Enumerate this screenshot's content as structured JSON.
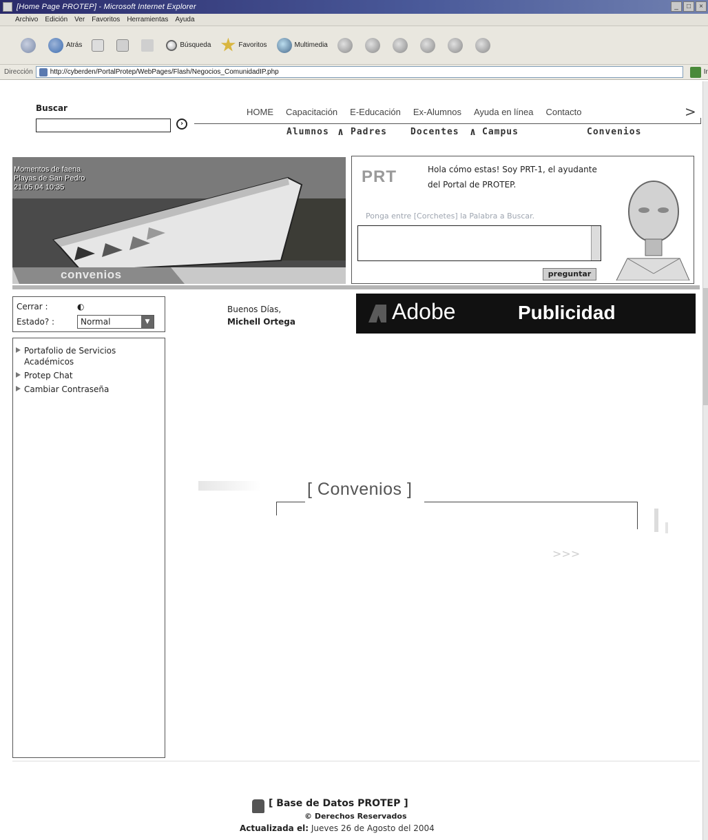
{
  "window": {
    "title": "[Home Page PROTEP] - Microsoft Internet Explorer"
  },
  "menubar": [
    "Archivo",
    "Edición",
    "Ver",
    "Favoritos",
    "Herramientas",
    "Ayuda"
  ],
  "toolbar": {
    "back_label": "Atrás",
    "search_label": "Búsqueda",
    "favorites_label": "Favoritos",
    "media_label": "Multimedia"
  },
  "address": {
    "label": "Dirección",
    "url": "http://cyberden/PortalProtep/WebPages/Flash/Negocios_ComunidadIP.php",
    "go_label": "Ir"
  },
  "search": {
    "label": "Buscar",
    "value": ""
  },
  "nav": {
    "top": [
      "HOME",
      "Capacitación",
      "E-Educación",
      "Ex-Alumnos",
      "Ayuda en línea",
      "Contacto"
    ],
    "more": ">",
    "sub": {
      "alumnos": "Alumnos",
      "padres": "Padres",
      "docentes": "Docentes",
      "campus": "Campus",
      "convenios": "Convenios"
    }
  },
  "banner": {
    "caption_line1": "Momentos de faena",
    "caption_line2": "Playas de San Pedro",
    "caption_line3": "21.05.04 10:35",
    "section": "convenios"
  },
  "assistant": {
    "logo": "PRT",
    "greeting": "Hola cómo estas! Soy PRT-1, el ayudante del Portal de PROTEP.",
    "hint": "Ponga entre [Corchetes] la Palabra a Buscar.",
    "ask_value": "",
    "ask_button": "preguntar"
  },
  "status": {
    "close_label": "Cerrar :",
    "state_label": "Estado? :",
    "state_value": "Normal"
  },
  "greeting": {
    "salutation": "Buenos Días,",
    "name": "Michell Ortega"
  },
  "ad": {
    "brand": "Adobe",
    "label": "Publicidad"
  },
  "left_menu": [
    "Portafolio de Servicios Académicos",
    "Protep Chat",
    "Cambiar Contraseña"
  ],
  "content": {
    "title": "[ Convenios ]"
  },
  "footer": {
    "title": "[ Base de Datos PROTEP ]",
    "rights": "© Derechos Reservados",
    "updated_label": "Actualizada el:",
    "updated_date": "Jueves 26 de Agosto del 2004"
  }
}
